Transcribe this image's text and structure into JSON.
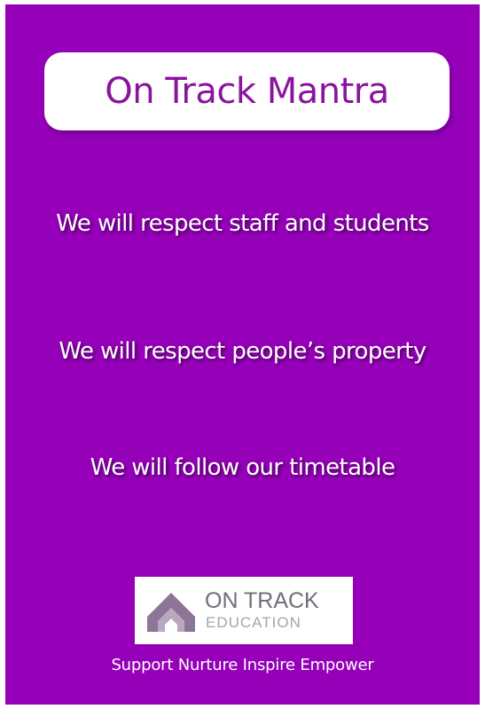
{
  "title": "On Track Mantra",
  "mantras": [
    "We will respect staff and students",
    "We will respect people’s property",
    "We will follow our timetable"
  ],
  "logo": {
    "line1": "ON TRACK",
    "line2": "EDUCATION",
    "icon": "chevron-arch-logo-icon"
  },
  "tagline": "Support Nurture Inspire Empower",
  "colors": {
    "background": "#9500b8",
    "title_text": "#8a149e",
    "logo_text": "#6f6f78",
    "logo_subtext": "#a6a6ad"
  }
}
